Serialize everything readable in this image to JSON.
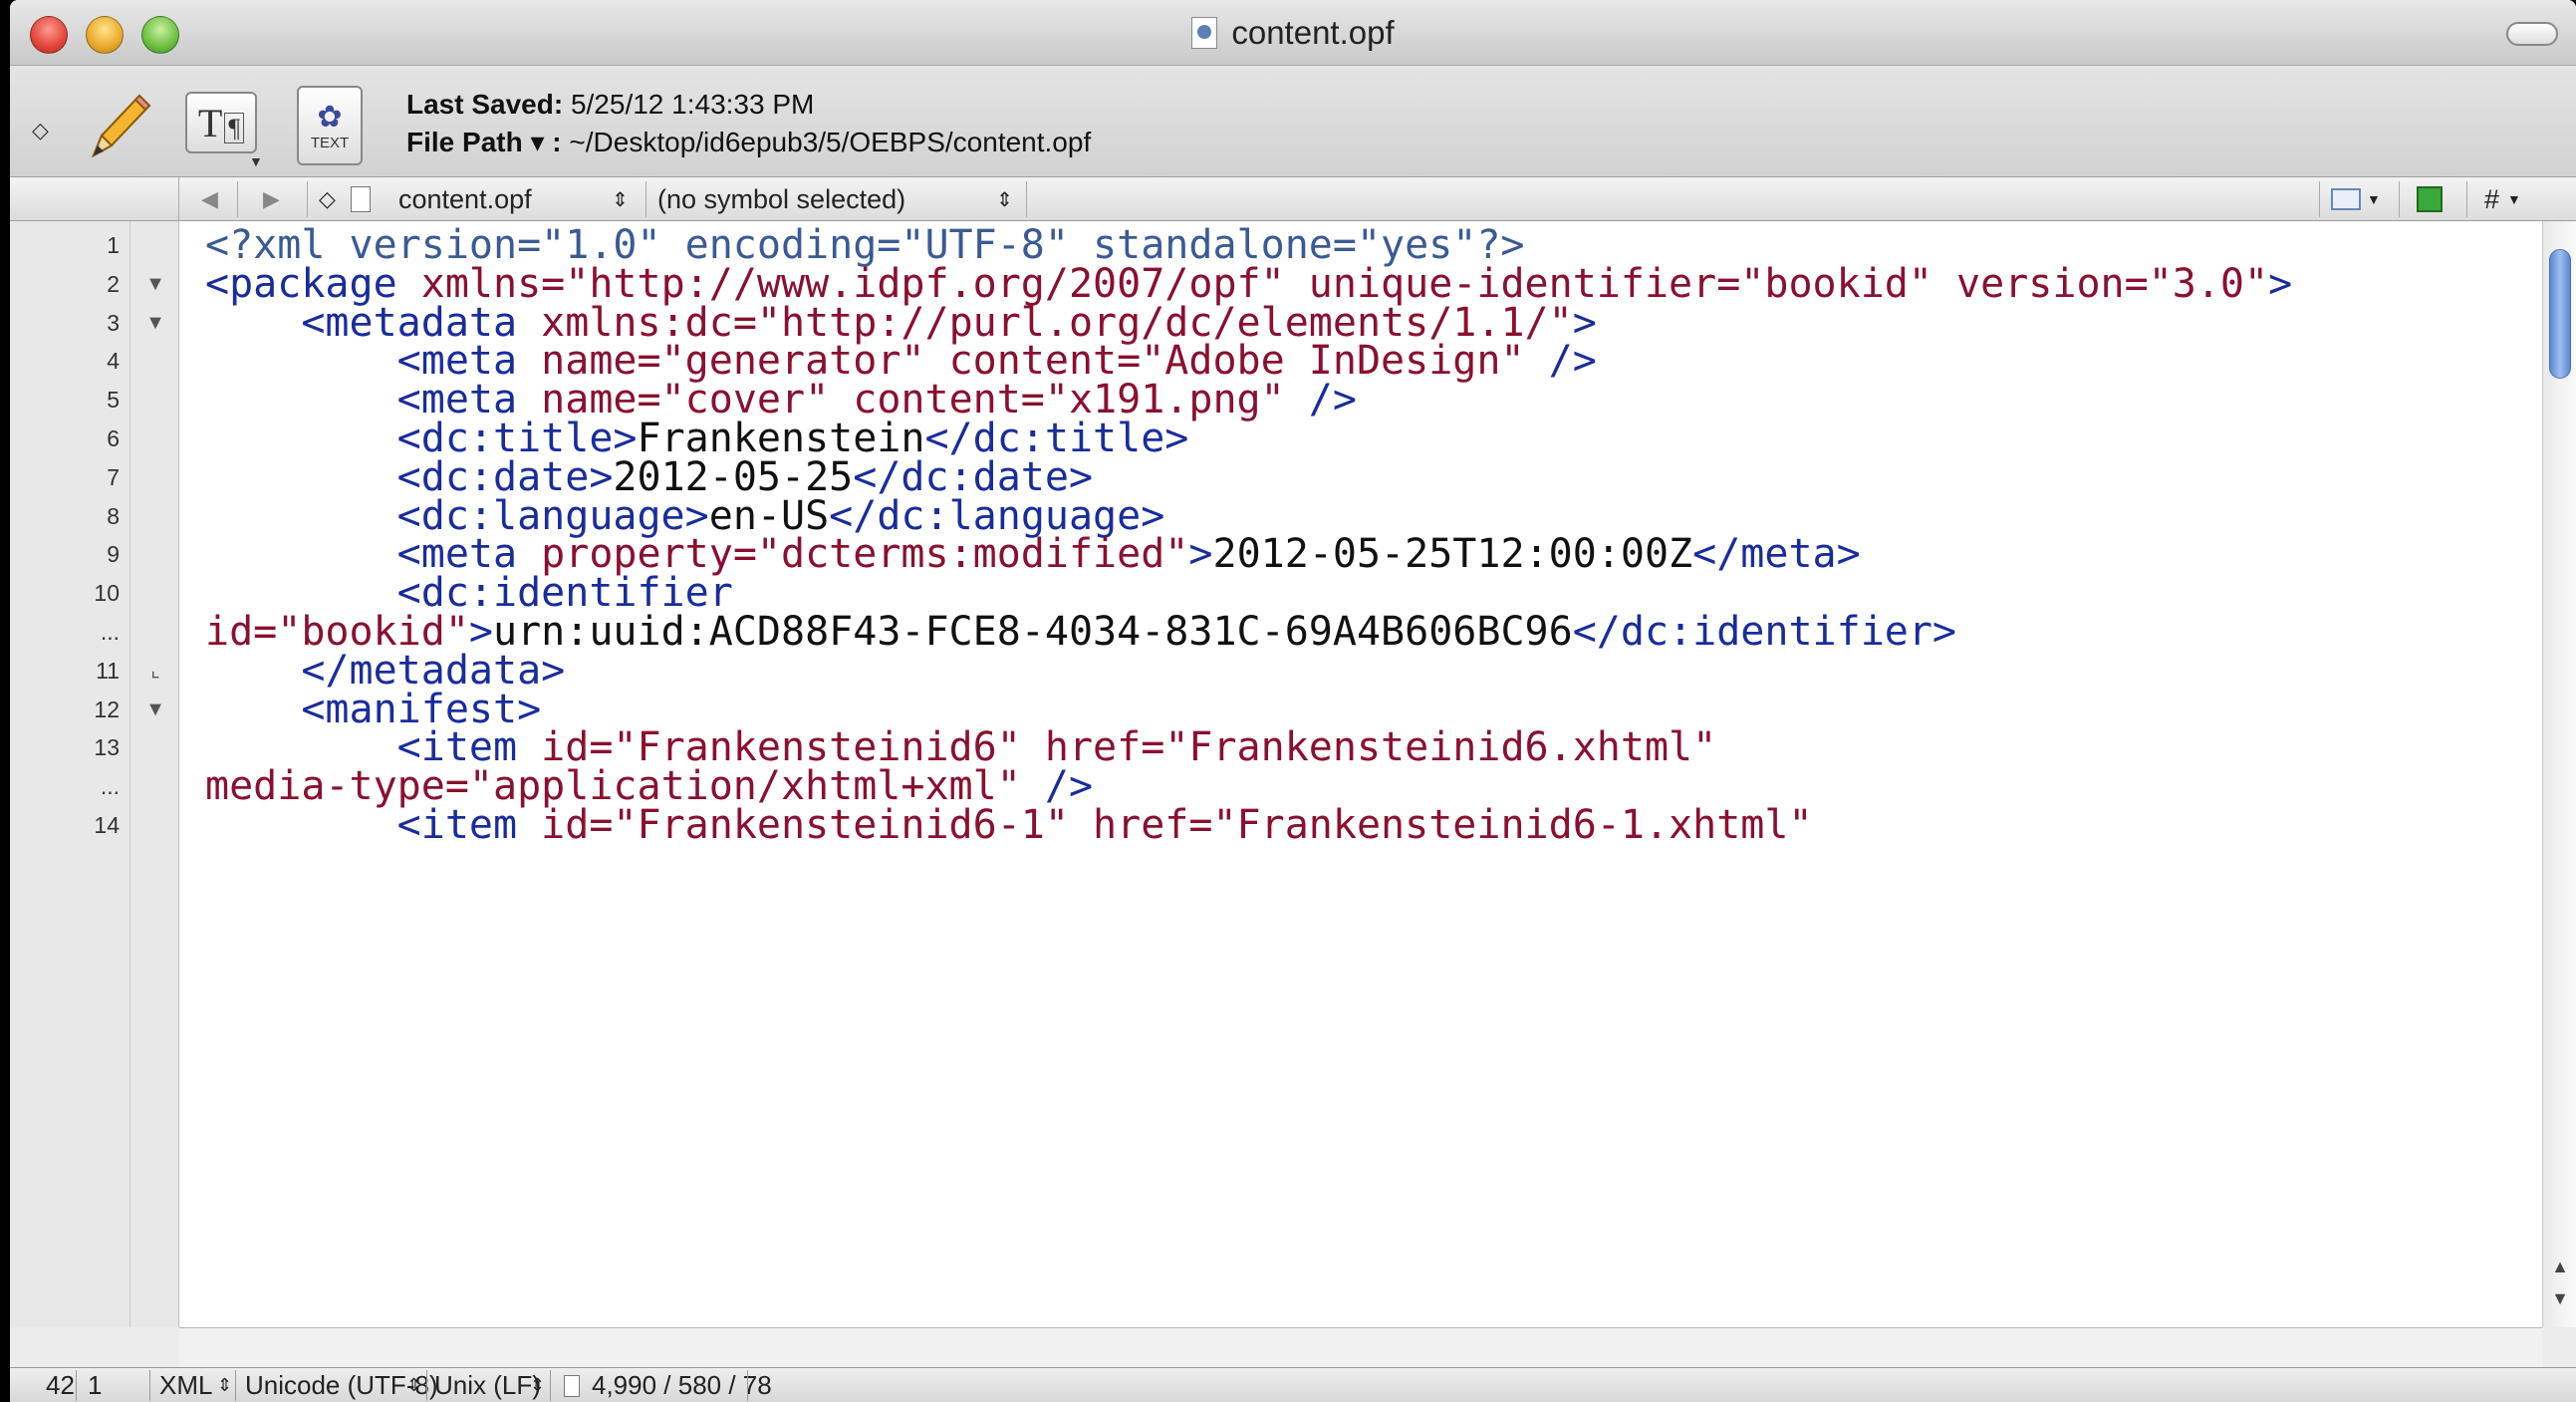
{
  "window": {
    "title": "content.opf"
  },
  "toolbar": {
    "last_saved_label": "Last Saved:",
    "last_saved_value": "5/25/12 1:43:33 PM",
    "file_path_label": "File Path ▾ :",
    "file_path_value": "~/Desktop/id6epub3/5/OEBPS/content.opf",
    "text_button_label": "TEXT"
  },
  "navbar": {
    "back_glyph": "◀",
    "forward_glyph": "▶",
    "file_name": "content.opf",
    "symbol": "(no symbol selected)",
    "hash_label": "#"
  },
  "editor": {
    "lines": [
      {
        "n": "1",
        "fold": "",
        "indent": "",
        "segs": [
          [
            "pi",
            "<?xml version=\"1.0\" encoding=\"UTF-8\" standalone=\"yes\"?>"
          ]
        ]
      },
      {
        "n": "2",
        "fold": "▼",
        "indent": "",
        "segs": [
          [
            "tag",
            "<package "
          ],
          [
            "attr",
            "xmlns="
          ],
          [
            "str",
            "\"http://www.idpf.org/2007/opf\" "
          ],
          [
            "attr",
            "unique-identifier="
          ],
          [
            "str",
            "\"bookid\" "
          ],
          [
            "attr",
            "version="
          ],
          [
            "str",
            "\"3.0\""
          ],
          [
            "tag",
            ">"
          ]
        ]
      },
      {
        "n": "3",
        "fold": "▼",
        "indent": "    ",
        "segs": [
          [
            "tag",
            "<metadata "
          ],
          [
            "attr",
            "xmlns:dc="
          ],
          [
            "str",
            "\"http://purl.org/dc/elements/1.1/\""
          ],
          [
            "tag",
            ">"
          ]
        ]
      },
      {
        "n": "4",
        "fold": "",
        "indent": "        ",
        "segs": [
          [
            "tag",
            "<meta "
          ],
          [
            "attr",
            "name="
          ],
          [
            "str",
            "\"generator\" "
          ],
          [
            "attr",
            "content="
          ],
          [
            "str",
            "\"Adobe InDesign\" "
          ],
          [
            "tag",
            "/>"
          ]
        ]
      },
      {
        "n": "5",
        "fold": "",
        "indent": "        ",
        "segs": [
          [
            "tag",
            "<meta "
          ],
          [
            "attr",
            "name="
          ],
          [
            "str",
            "\"cover\" "
          ],
          [
            "attr",
            "content="
          ],
          [
            "str",
            "\"x191.png\" "
          ],
          [
            "tag",
            "/>"
          ]
        ]
      },
      {
        "n": "6",
        "fold": "",
        "indent": "        ",
        "segs": [
          [
            "tag",
            "<dc:title>"
          ],
          [
            "txt",
            "Frankenstein"
          ],
          [
            "tag",
            "</dc:title>"
          ]
        ]
      },
      {
        "n": "7",
        "fold": "",
        "indent": "        ",
        "segs": [
          [
            "tag",
            "<dc:date>"
          ],
          [
            "txt",
            "2012-05-25"
          ],
          [
            "tag",
            "</dc:date>"
          ]
        ]
      },
      {
        "n": "8",
        "fold": "",
        "indent": "        ",
        "segs": [
          [
            "tag",
            "<dc:language>"
          ],
          [
            "txt",
            "en-US"
          ],
          [
            "tag",
            "</dc:language>"
          ]
        ]
      },
      {
        "n": "9",
        "fold": "",
        "indent": "        ",
        "segs": [
          [
            "tag",
            "<meta "
          ],
          [
            "attr",
            "property="
          ],
          [
            "str",
            "\"dcterms:modified\""
          ],
          [
            "tag",
            ">"
          ],
          [
            "txt",
            "2012-05-25T12:00:00Z"
          ],
          [
            "tag",
            "</meta>"
          ]
        ]
      },
      {
        "n": "10",
        "fold": "",
        "indent": "        ",
        "segs": [
          [
            "tag",
            "<dc:identifier"
          ]
        ]
      },
      {
        "n": "...",
        "fold": "",
        "indent": "",
        "segs": [
          [
            "attr",
            "id="
          ],
          [
            "str",
            "\"bookid\""
          ],
          [
            "tag",
            ">"
          ],
          [
            "txt",
            "urn:uuid:ACD88F43-FCE8-4034-831C-69A4B606BC96"
          ],
          [
            "tag",
            "</dc:identifier>"
          ]
        ]
      },
      {
        "n": "11",
        "fold": "⌞",
        "indent": "    ",
        "segs": [
          [
            "tag",
            "</metadata>"
          ]
        ]
      },
      {
        "n": "12",
        "fold": "▼",
        "indent": "    ",
        "segs": [
          [
            "tag",
            "<manifest>"
          ]
        ]
      },
      {
        "n": "13",
        "fold": "",
        "indent": "        ",
        "segs": [
          [
            "tag",
            "<item "
          ],
          [
            "attr",
            "id="
          ],
          [
            "str",
            "\"Frankensteinid6\" "
          ],
          [
            "attr",
            "href="
          ],
          [
            "str",
            "\"Frankensteinid6.xhtml\""
          ]
        ]
      },
      {
        "n": "...",
        "fold": "",
        "indent": "",
        "segs": [
          [
            "attr",
            "media-type="
          ],
          [
            "str",
            "\"application/xhtml+xml\" "
          ],
          [
            "tag",
            "/>"
          ]
        ]
      },
      {
        "n": "14",
        "fold": "",
        "indent": "        ",
        "segs": [
          [
            "tag",
            "<item "
          ],
          [
            "attr",
            "id="
          ],
          [
            "str",
            "\"Frankensteinid6-1\" "
          ],
          [
            "attr",
            "href="
          ],
          [
            "str",
            "\"Frankensteinid6-1.xhtml\""
          ]
        ]
      }
    ]
  },
  "statusbar": {
    "line": "42",
    "column": "1",
    "syntax": "XML",
    "encoding": "Unicode (UTF-8)",
    "line_endings": "Unix (LF)",
    "counts": "4,990 / 580 / 78"
  },
  "colors": {
    "tag": "#1a2c9c",
    "attr": "#8a1030",
    "pi": "#3a5a94",
    "text": "#111111"
  }
}
